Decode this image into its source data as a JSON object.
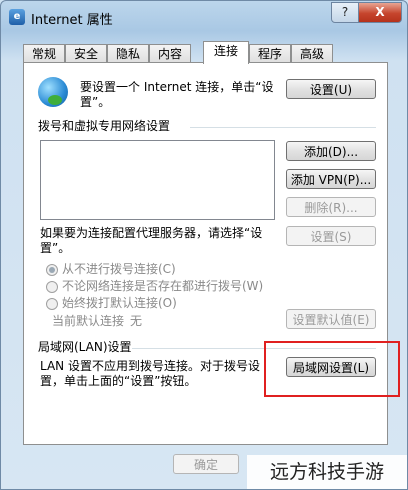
{
  "window": {
    "title": "Internet 属性",
    "help_label": "?",
    "close_label": "X"
  },
  "tabs": [
    {
      "label": "常规"
    },
    {
      "label": "安全"
    },
    {
      "label": "隐私"
    },
    {
      "label": "内容"
    },
    {
      "label": "连接",
      "active": true
    },
    {
      "label": "程序"
    },
    {
      "label": "高级"
    }
  ],
  "setup": {
    "text_line1": "要设置一个 Internet 连接，单击“设",
    "text_line2": "置”。",
    "button_label": "设置(U)"
  },
  "dialup": {
    "group_title": "拨号和虚拟专用网络设置",
    "add_button": "添加(D)...",
    "add_vpn_button": "添加 VPN(P)...",
    "remove_button": "删除(R)...",
    "proxy_text_line1": "如果要为连接配置代理服务器，请选择“设",
    "proxy_text_line2": "置”。",
    "settings_button": "设置(S)",
    "radio_options": [
      {
        "label": "从不进行拨号连接(C)",
        "checked": true
      },
      {
        "label": "不论网络连接是否存在都进行拨号(W)",
        "checked": false
      },
      {
        "label": "始终拨打默认连接(O)",
        "checked": false
      }
    ],
    "current_default_label": "当前默认连接",
    "current_default_value": "无",
    "set_default_button": "设置默认值(E)"
  },
  "lan": {
    "group_title": "局域网(LAN)设置",
    "text_line1": "LAN 设置不应用到拨号连接。对于拨号设",
    "text_line2": "置，单击上面的“设置”按钮。",
    "lan_button": "局域网设置(L)"
  },
  "footer": {
    "ok_button": "确定"
  },
  "watermark": "远方科技手游",
  "colors": {
    "highlight_border": "#e02020",
    "close_button": "#c6452d"
  }
}
